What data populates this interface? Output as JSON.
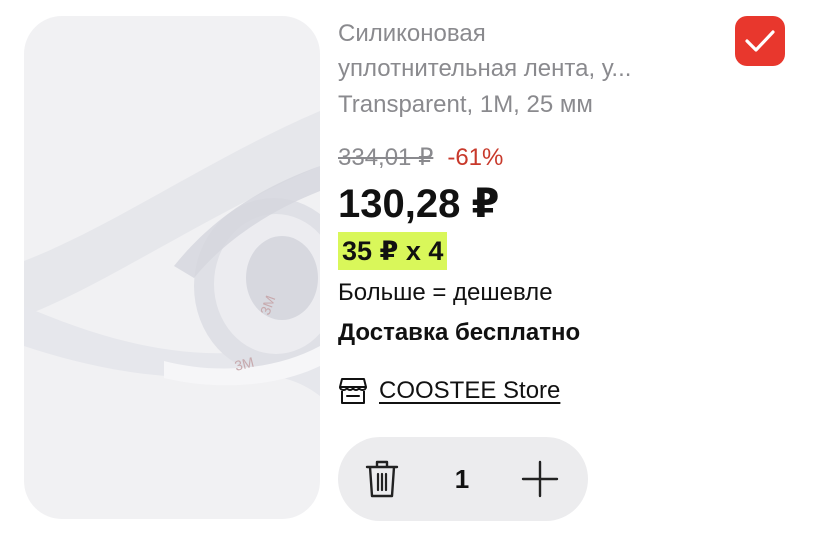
{
  "product": {
    "title_line1": "Силиконовая",
    "title_line2": "уплотнительная лента, у...",
    "title_line3": "Transparent, 1M, 25 мм",
    "image_icon": "product-image-tape",
    "image_watermark": "3M"
  },
  "pricing": {
    "old_price": "334,01 ₽",
    "discount": "-61%",
    "price": "130,28 ₽",
    "promo": "35 ₽ x 4",
    "more_cheaper": "Больше = дешевле",
    "delivery": "Доставка бесплатно"
  },
  "store": {
    "icon": "store-icon",
    "name": "COOSTEE Store"
  },
  "cart": {
    "quantity": "1",
    "remove_icon": "trash-icon",
    "add_icon": "plus-icon"
  },
  "selection": {
    "checked": true,
    "icon": "checkmark-icon"
  },
  "colors": {
    "accent_red": "#e8372d",
    "discount_red": "#c8392b",
    "promo_highlight": "#d9f75a",
    "muted_text": "#8a8a8e",
    "stepper_bg": "#ececee",
    "image_bg": "#f1f1f3"
  }
}
